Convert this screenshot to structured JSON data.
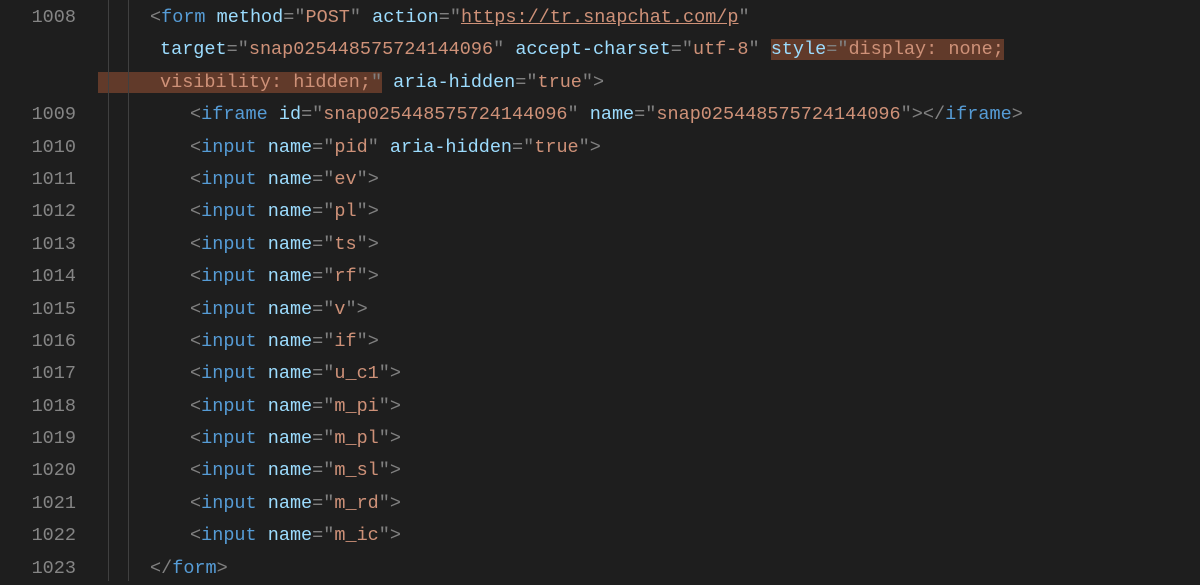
{
  "gutter": [
    "1008",
    "1009",
    "1010",
    "1011",
    "1012",
    "1013",
    "1014",
    "1015",
    "1016",
    "1017",
    "1018",
    "1019",
    "1020",
    "1021",
    "1022",
    "1023"
  ],
  "form": {
    "tag": "form",
    "attrs": {
      "method_k": "method",
      "method_v": "POST",
      "action_k": "action",
      "action_v": "https://tr.snapchat.com/p",
      "target_k": "target",
      "target_v": "snap025448575724144096",
      "accept_k": "accept-charset",
      "accept_v": "utf-8",
      "style_k": "style",
      "style_v_a": "display: none;",
      "style_v_b": "visibility: hidden;",
      "aria_k": "aria-hidden",
      "aria_v": "true"
    }
  },
  "iframe": {
    "tag": "iframe",
    "id_k": "id",
    "id_v": "snap025448575724144096",
    "name_k": "name",
    "name_v": "snap025448575724144096"
  },
  "input_tag": "input",
  "name_k": "name",
  "aria_k": "aria-hidden",
  "aria_true": "true",
  "inputs": {
    "pid": "pid",
    "ev": "ev",
    "pl": "pl",
    "ts": "ts",
    "rf": "rf",
    "v": "v",
    "if": "if",
    "u_c1": "u_c1",
    "m_pi": "m_pi",
    "m_pl": "m_pl",
    "m_sl": "m_sl",
    "m_rd": "m_rd",
    "m_ic": "m_ic"
  },
  "form_close": "form"
}
